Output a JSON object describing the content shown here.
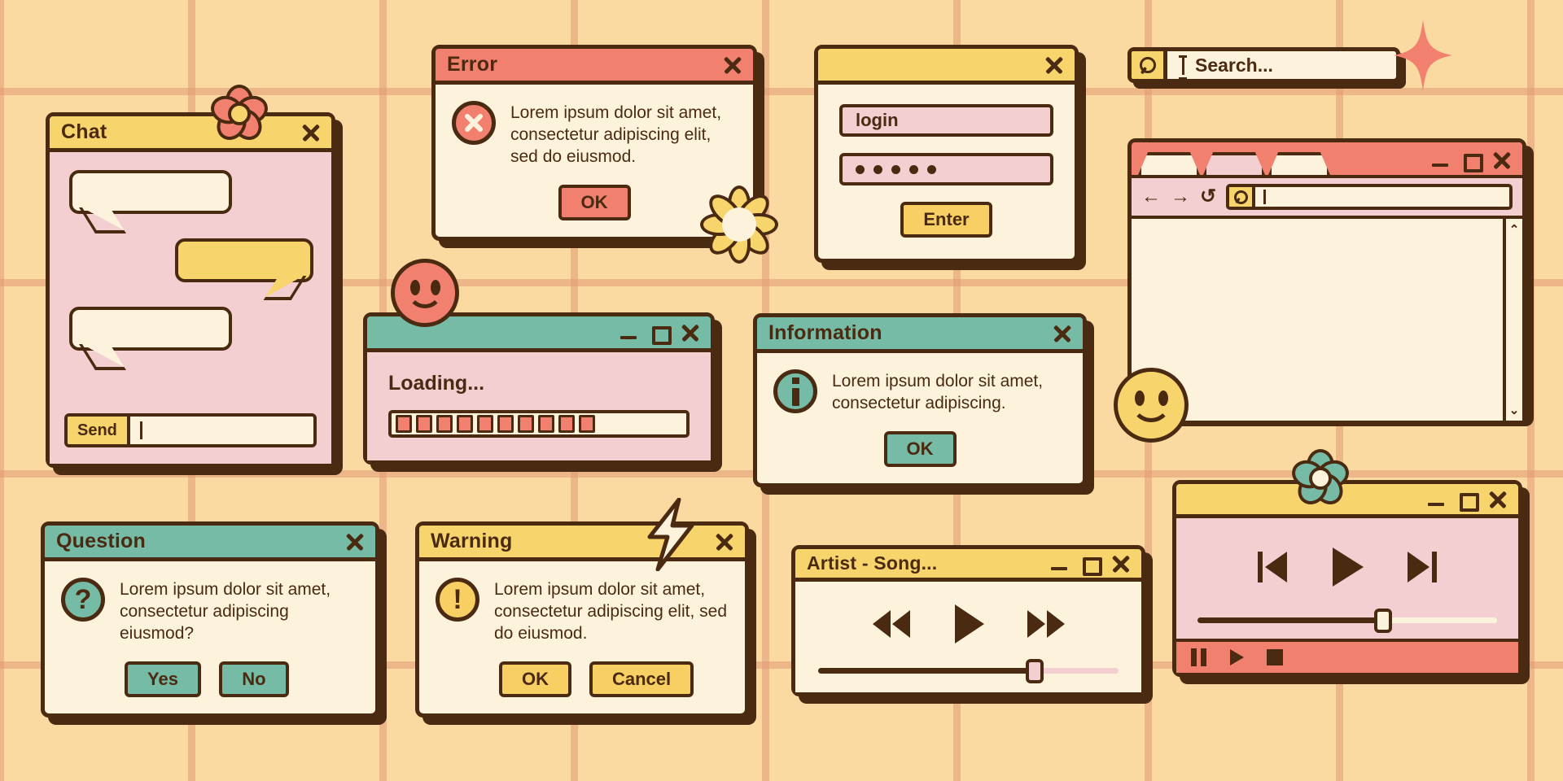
{
  "theme": {
    "bg": "#fadaa0",
    "grid": "#e29a75",
    "ink": "#4a2a11",
    "cream": "#fdf3dd",
    "pink": "#f3cfd1",
    "yellow": "#f8d46c",
    "salmon": "#f2806f",
    "teal": "#76bba6"
  },
  "chat": {
    "title": "Chat",
    "close_label": "×",
    "send_label": "Send",
    "input_value": "",
    "bubbles": [
      "",
      "",
      ""
    ]
  },
  "error": {
    "title": "Error",
    "icon": "error-x-icon",
    "message": "Lorem ipsum dolor sit amet, consectetur adipiscing elit, sed do eiusmod.",
    "ok_label": "OK"
  },
  "login": {
    "title": "",
    "username_value": "login",
    "password_value": "•••••",
    "password_dots": 5,
    "enter_label": "Enter"
  },
  "searchbar": {
    "icon": "search-icon",
    "placeholder": "Search..."
  },
  "browser": {
    "tabs": [
      "",
      "",
      ""
    ],
    "active_tab_index": 1,
    "back_label": "←",
    "forward_label": "→",
    "reload_label": "↺",
    "url_value": "",
    "scroll_up": "⌃",
    "scroll_down": "⌄",
    "minimize_label": "_",
    "maximize_label": "□",
    "close_label": "×"
  },
  "loading": {
    "title": "",
    "label": "Loading...",
    "blocks_filled": 10,
    "blocks_total": 15
  },
  "information": {
    "title": "Information",
    "icon": "info-icon",
    "message": "Lorem ipsum dolor sit amet, consectetur adipiscing.",
    "ok_label": "OK"
  },
  "question": {
    "title": "Question",
    "icon": "question-mark-icon",
    "message": "Lorem ipsum dolor sit amet, consectetur adipiscing eiusmod?",
    "yes_label": "Yes",
    "no_label": "No"
  },
  "warning": {
    "title": "Warning",
    "icon": "warning-exclamation-icon",
    "message": "Lorem ipsum dolor sit amet, consectetur adipiscing elit, sed do eiusmod.",
    "ok_label": "OK",
    "cancel_label": "Cancel"
  },
  "music": {
    "title": "Artist - Song...",
    "rewind": "rewind-icon",
    "play": "play-icon",
    "forward": "fast-forward-icon",
    "progress_percent": 72
  },
  "video": {
    "title": "",
    "previous": "skip-previous-icon",
    "play": "play-icon",
    "next": "skip-next-icon",
    "progress_percent": 62,
    "pause": "pause-icon",
    "small_play": "play-icon",
    "stop": "stop-icon"
  },
  "decorations": {
    "chat_flower": "pink-flower",
    "error_daisy": "yellow-daisy",
    "video_flower": "teal-flower",
    "sparkle": "four-point-star",
    "smiley_pink": "smiley-face",
    "smiley_yellow": "smiley-face",
    "lightning": "lightning-bolt"
  }
}
